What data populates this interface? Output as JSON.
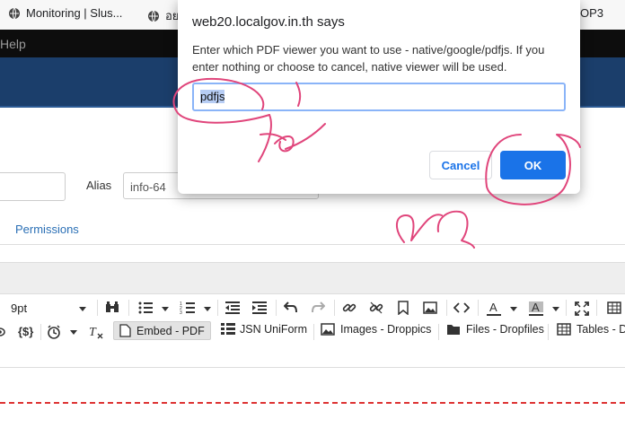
{
  "bookmarks": [
    {
      "label": "Monitoring | Slus...",
      "icon": "globe-icon"
    },
    {
      "label": "อย",
      "icon": "globe-icon"
    },
    {
      "label": "OP3",
      "icon": ""
    }
  ],
  "menubar": {
    "help_label": "Help"
  },
  "form": {
    "alias_label": "Alias",
    "alias_value": "info-64",
    "permissions_tab": "Permissions"
  },
  "editor": {
    "font_size": "9pt",
    "plugins": [
      {
        "label": "Embed - PDF",
        "icon": "file-icon",
        "active": true
      },
      {
        "label": "JSN UniForm",
        "icon": "list-icon",
        "active": false
      },
      {
        "label": "Images - Droppics",
        "icon": "image-icon",
        "active": false
      },
      {
        "label": "Files - Dropfiles",
        "icon": "folder-icon",
        "active": false
      },
      {
        "label": "Tables - D",
        "icon": "table-icon",
        "active": false
      }
    ],
    "code_braces_label": "{$}"
  },
  "dialog": {
    "title": "web20.localgov.in.th says",
    "message": "Enter which PDF viewer you want to use - native/google/pdfjs. If you enter nothing or choose to cancel, native viewer will be used.",
    "input_value": "pdfjs",
    "cancel_label": "Cancel",
    "ok_label": "OK"
  },
  "colors": {
    "header_blue": "#1b3e6b",
    "ok_blue": "#1a73e8",
    "annotation_pink": "#e0457b"
  }
}
